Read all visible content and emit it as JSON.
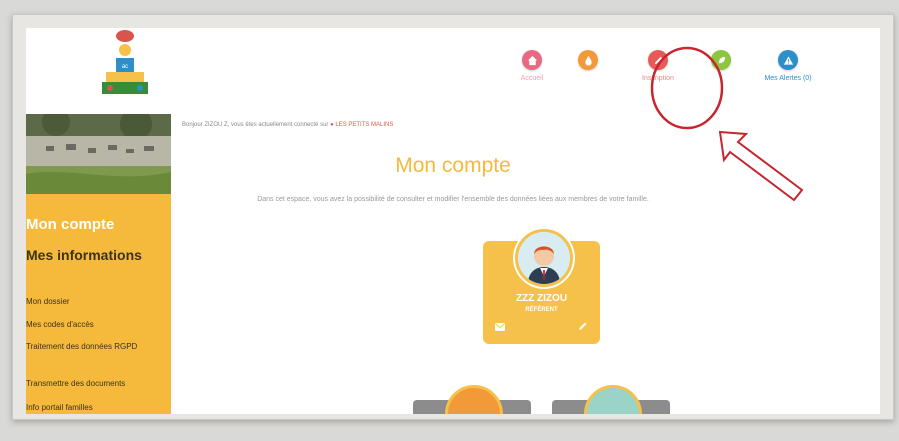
{
  "header": {
    "nav": [
      {
        "label": "Accueil",
        "icon": "home-icon",
        "color": "#e86a82"
      },
      {
        "label": "",
        "icon": "drop-icon",
        "color": "#f29a3a"
      },
      {
        "label": "Inscription",
        "icon": "pencil-icon",
        "color": "#e85a58"
      },
      {
        "label": "",
        "icon": "leaf-icon",
        "color": "#8cc63f"
      },
      {
        "label": "Mes Alertes (0)",
        "icon": "warning-icon",
        "color": "#2d8fc9"
      }
    ]
  },
  "sidebar": {
    "title": "Mon compte",
    "section": "Mes informations",
    "links": [
      "Mon dossier",
      "Mes codes d'accès",
      "Traitement des données RGPD",
      "Transmettre des documents",
      "Info portail familles"
    ]
  },
  "main": {
    "greeting_prefix": "Bonjour ZIZOU Z, vous êtes actuellement connecté sur",
    "greeting_site": "LES PETITS MALINS",
    "title": "Mon compte",
    "description": "Dans cet espace, vous avez la possibilité de consulter et modifier l'ensemble des données liées aux membres de votre famille.",
    "member": {
      "name": "ZZZ ZIZOU",
      "role": "RÉFÉRENT"
    }
  },
  "colors": {
    "accent": "#f5b93c",
    "annotation": "#c6262e"
  }
}
